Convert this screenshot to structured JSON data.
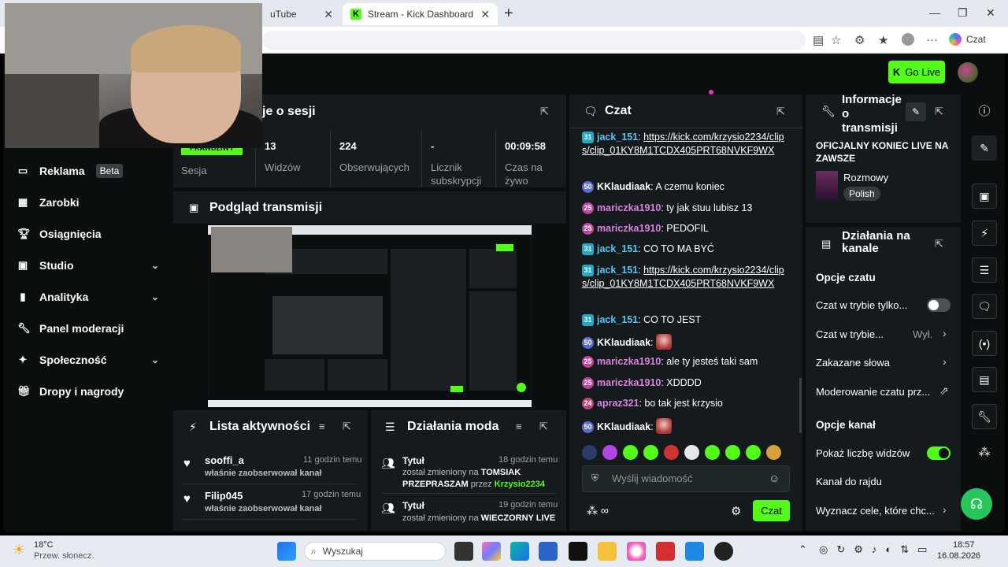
{
  "browser": {
    "tabs": [
      {
        "label": "uTube"
      },
      {
        "label": "Stream - Kick Dashboard"
      }
    ],
    "copilot_label": "Czat"
  },
  "header": {
    "go_live": "Go Live"
  },
  "sidebar": {
    "items": [
      {
        "label": "Reklama",
        "badge": "Beta"
      },
      {
        "label": "Zarobki"
      },
      {
        "label": "Osiągnięcia"
      },
      {
        "label": "Studio"
      },
      {
        "label": "Analityka"
      },
      {
        "label": "Panel moderacji"
      },
      {
        "label": "Społeczność"
      },
      {
        "label": "Dropy i nagrody"
      }
    ]
  },
  "session": {
    "title": "je o sesji",
    "status_partial": "PRAWDZIWY",
    "stats": [
      {
        "value": "",
        "label": "Sesja"
      },
      {
        "value": "13",
        "label": "Widzów"
      },
      {
        "value": "224",
        "label": "Obserwujących"
      },
      {
        "value": "-",
        "label": "Licznik subskrypcji"
      },
      {
        "value": "00:09:58",
        "label": "Czas na żywo"
      }
    ]
  },
  "preview": {
    "title": "Podgląd transmisji"
  },
  "activity": {
    "title": "Lista aktywności",
    "items": [
      {
        "name": "sooffi_a",
        "time": "11 godzin temu",
        "desc": "właśnie zaobserwował kanał"
      },
      {
        "name": "Filip045",
        "time": "17 godzin temu",
        "desc": "właśnie zaobserwował kanał"
      }
    ]
  },
  "modactions": {
    "title": "Działania moda",
    "items": [
      {
        "title": "Tytuł",
        "time": "18 godzin temu",
        "pre": "został zmieniony na ",
        "bold": "TOMSIAK PRZEPRASZAM",
        "mid": " przez ",
        "user": "Krzysio2234"
      },
      {
        "title": "Tytuł",
        "time": "19 godzin temu",
        "pre": "został zmieniony na ",
        "bold": "WIECZORNY LIVE",
        "mid": "",
        "user": ""
      }
    ]
  },
  "chat": {
    "title": "Czat",
    "input_placeholder": "Wyślij wiadomość",
    "send_label": "Czat",
    "messages": [
      {
        "badge": "31",
        "user": "jack_151",
        "text": "https://kick.com/krzysio2234/clips/clip_01KY8M1TCDX405PRT68NVKF9WX"
      },
      {
        "badge": "50",
        "user": "KKlaudiaak",
        "text": "A czemu koniec"
      },
      {
        "badge": "25",
        "user": "mariczka1910",
        "text": "ty jak stuu lubisz 13"
      },
      {
        "badge": "25",
        "user": "mariczka1910",
        "text": "PEDOFIL"
      },
      {
        "badge": "31",
        "user": "jack_151",
        "text": "CO TO MA BYĆ"
      },
      {
        "badge": "31",
        "user": "jack_151",
        "text": "https://kick.com/krzysio2234/clips/clip_01KY8M1TCDX405PRT68NVKF9WX"
      },
      {
        "badge": "31",
        "user": "jack_151",
        "text": "CO TO JEST"
      },
      {
        "badge": "50",
        "user": "KKlaudiaak",
        "text": ""
      },
      {
        "badge": "25",
        "user": "mariczka1910",
        "text": "ale ty jesteś taki sam"
      },
      {
        "badge": "25",
        "user": "mariczka1910",
        "text": "XDDDD"
      },
      {
        "badge": "24",
        "user": "apraz321",
        "text": "bo tak jest krzysio"
      },
      {
        "badge": "50",
        "user": "KKlaudiaak",
        "text": ""
      }
    ]
  },
  "info": {
    "title": "Informacje o transmisji",
    "stream_title": "OFICJALNY KONIEC LIVE NA ZAWSZE",
    "category": "Rozmowy",
    "language": "Polish"
  },
  "channel_actions": {
    "title": "Działania na kanale",
    "chat_options": "Opcje czatu",
    "rows1": [
      {
        "label": "Czat w trybie tylko..."
      },
      {
        "label": "Czat w trybie...",
        "value": "Wył."
      },
      {
        "label": "Zakazane słowa"
      },
      {
        "label": "Moderowanie czatu prz..."
      }
    ],
    "channel_options": "Opcje kanał",
    "rows2": [
      {
        "label": "Pokaż liczbę widzów"
      },
      {
        "label": "Kanał do rajdu"
      },
      {
        "label": "Wyznacz cele, które chc..."
      }
    ]
  },
  "taskbar": {
    "temp": "18°C",
    "weather": "Przew. słonecz.",
    "search": "Wyszukaj",
    "time": "18:57",
    "date": "16.08.2026"
  },
  "colors": {
    "accent": "#53fc18",
    "panel": "#151a1c",
    "bg": "#0b0e0f"
  }
}
